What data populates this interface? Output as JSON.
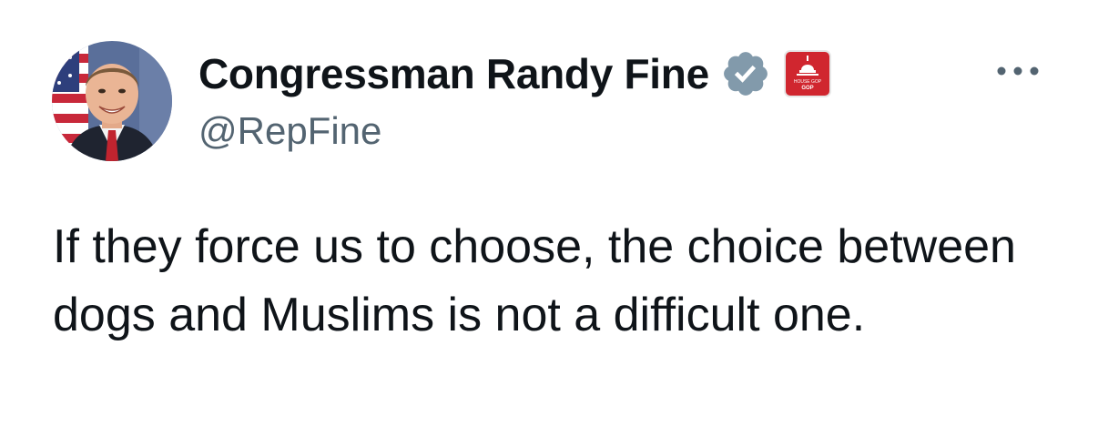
{
  "author": {
    "display_name": "Congressman Randy Fine",
    "handle": "@RepFine",
    "verified_badge_icon": "verified-badge-icon",
    "verified_badge_color": "#829aab",
    "affiliation_badge_icon": "capitol-dome-icon",
    "affiliation_badge_color": "#d0262f",
    "affiliation_badge_text": "HOUSE GOP"
  },
  "more_menu_icon": "more-horizontal-icon",
  "tweet": {
    "text": "If they force us to choose, the choice between dogs and Muslims is not a difficult one."
  }
}
